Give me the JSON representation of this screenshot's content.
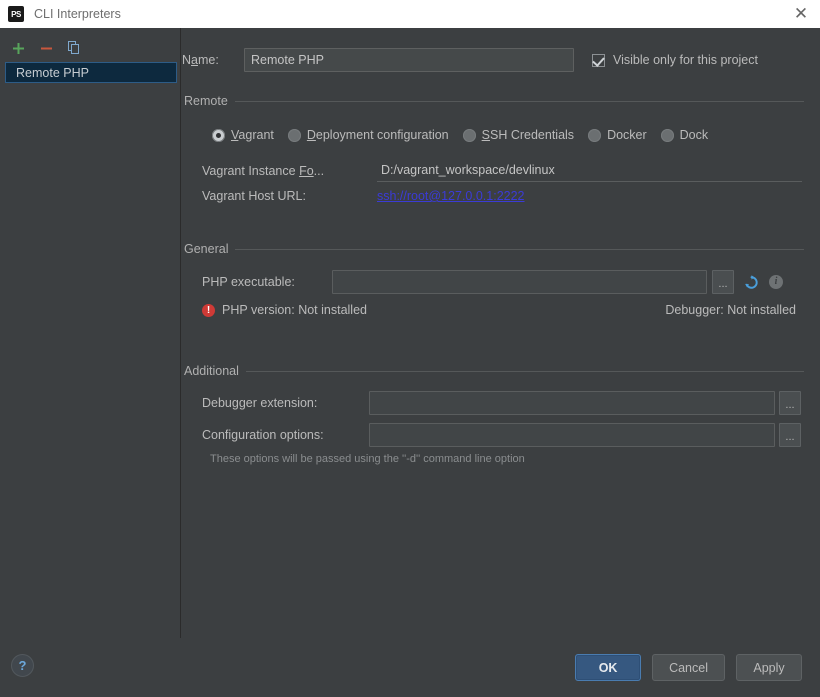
{
  "window": {
    "title": "CLI Interpreters",
    "app_icon": "phpstorm-icon",
    "app_icon_text": "PS",
    "close_icon": "✕"
  },
  "sidebar": {
    "toolbar": [
      {
        "name": "add-button",
        "glyph": "+",
        "color": "#58a55c"
      },
      {
        "name": "remove-button",
        "glyph": "−",
        "color": "#c9573d"
      },
      {
        "name": "copy-button",
        "glyph": "copy",
        "color": "#6b9fd4"
      }
    ],
    "items": [
      {
        "label": "Remote PHP",
        "selected": true
      }
    ]
  },
  "form": {
    "name_label": "Name:",
    "name_label_mnemonic": "a",
    "name_value": "Remote PHP",
    "visible_only_label": "Visible only for this project",
    "visible_only_checked": true
  },
  "remote": {
    "group_title": "Remote",
    "options": [
      {
        "label": "Vagrant",
        "mnemonic": "V",
        "selected": true
      },
      {
        "label": "Deployment configuration",
        "mnemonic": "D",
        "selected": false
      },
      {
        "label": "SSH Credentials",
        "mnemonic": "S",
        "selected": false
      },
      {
        "label": "Docker",
        "mnemonic": "",
        "selected": false
      },
      {
        "label": "Dock",
        "mnemonic": "",
        "selected": false
      }
    ],
    "instance_folder_label": "Vagrant Instance Fo...",
    "instance_folder_label_mnemonic": "Fo",
    "instance_folder_value": "D:/vagrant_workspace/devlinux",
    "host_url_label": "Vagrant Host URL:",
    "host_url_value": "ssh://root@127.0.0.1:2222"
  },
  "general": {
    "group_title": "General",
    "php_executable_label": "PHP executable:",
    "php_executable_value": "",
    "browse_label": "...",
    "refresh_icon": "refresh-icon",
    "info_icon": "info-icon",
    "php_version_status": "PHP version: Not installed",
    "php_version_icon": "error-icon",
    "debugger_status": "Debugger: Not installed"
  },
  "additional": {
    "group_title": "Additional",
    "debugger_extension_label": "Debugger extension:",
    "debugger_extension_value": "",
    "configuration_options_label": "Configuration options:",
    "configuration_options_value": "",
    "browse_label": "...",
    "hint": "These options will be passed using the ''-d'' command line option"
  },
  "footer": {
    "help_label": "?",
    "ok_label": "OK",
    "cancel_label": "Cancel",
    "apply_label": "Apply"
  },
  "colors": {
    "background": "#3c3f41",
    "titlebar": "#ffffff",
    "selection": "#0d293e",
    "accent_blue": "#365880",
    "link": "#3b3bd6",
    "error": "#cf3a36"
  }
}
